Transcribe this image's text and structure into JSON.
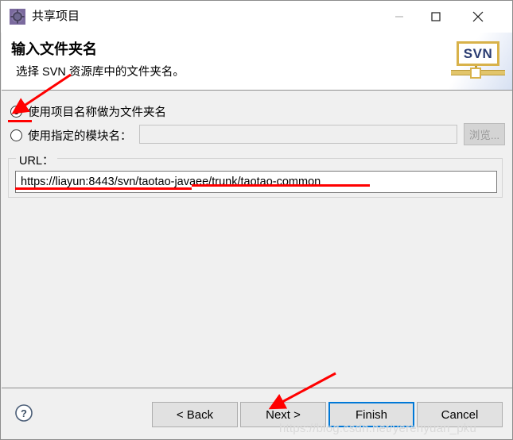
{
  "window": {
    "title": "共享项目",
    "icon": "share-project-icon",
    "minimize_label": "—",
    "maximize_label": "□",
    "close_label": "✕"
  },
  "header": {
    "title": "输入文件夹名",
    "description": "选择 SVN 资源库中的文件夹名。",
    "logo_text": "SVN"
  },
  "options": [
    {
      "id": "use-project-name",
      "label": "使用项目名称做为文件夹名",
      "checked": true
    },
    {
      "id": "use-specified-module",
      "label": "使用指定的模块名：",
      "checked": false,
      "input_value": "",
      "input_placeholder": "",
      "input_enabled": false,
      "browse_label": "浏览...",
      "browse_enabled": false
    }
  ],
  "url_group": {
    "legend": "URL：",
    "value": "https://liayun:8443/svn/taotao-javaee/trunk/taotao-common"
  },
  "footer": {
    "help_label": "?",
    "buttons": [
      {
        "id": "back",
        "label": "< Back",
        "enabled": true,
        "default": false
      },
      {
        "id": "next",
        "label": "Next >",
        "enabled": true,
        "default": false
      },
      {
        "id": "finish",
        "label": "Finish",
        "enabled": true,
        "default": true
      },
      {
        "id": "cancel",
        "label": "Cancel",
        "enabled": true,
        "default": false
      }
    ]
  },
  "watermark": "https://blog.csdn.net/yerenyuan_pku",
  "colors": {
    "accent": "#0078d7",
    "annotation": "#ff0000",
    "dialog_bg": "#f0f0f0",
    "header_bg": "#ffffff",
    "svn_frame": "#d8b24a",
    "svn_text": "#2a3c72"
  }
}
